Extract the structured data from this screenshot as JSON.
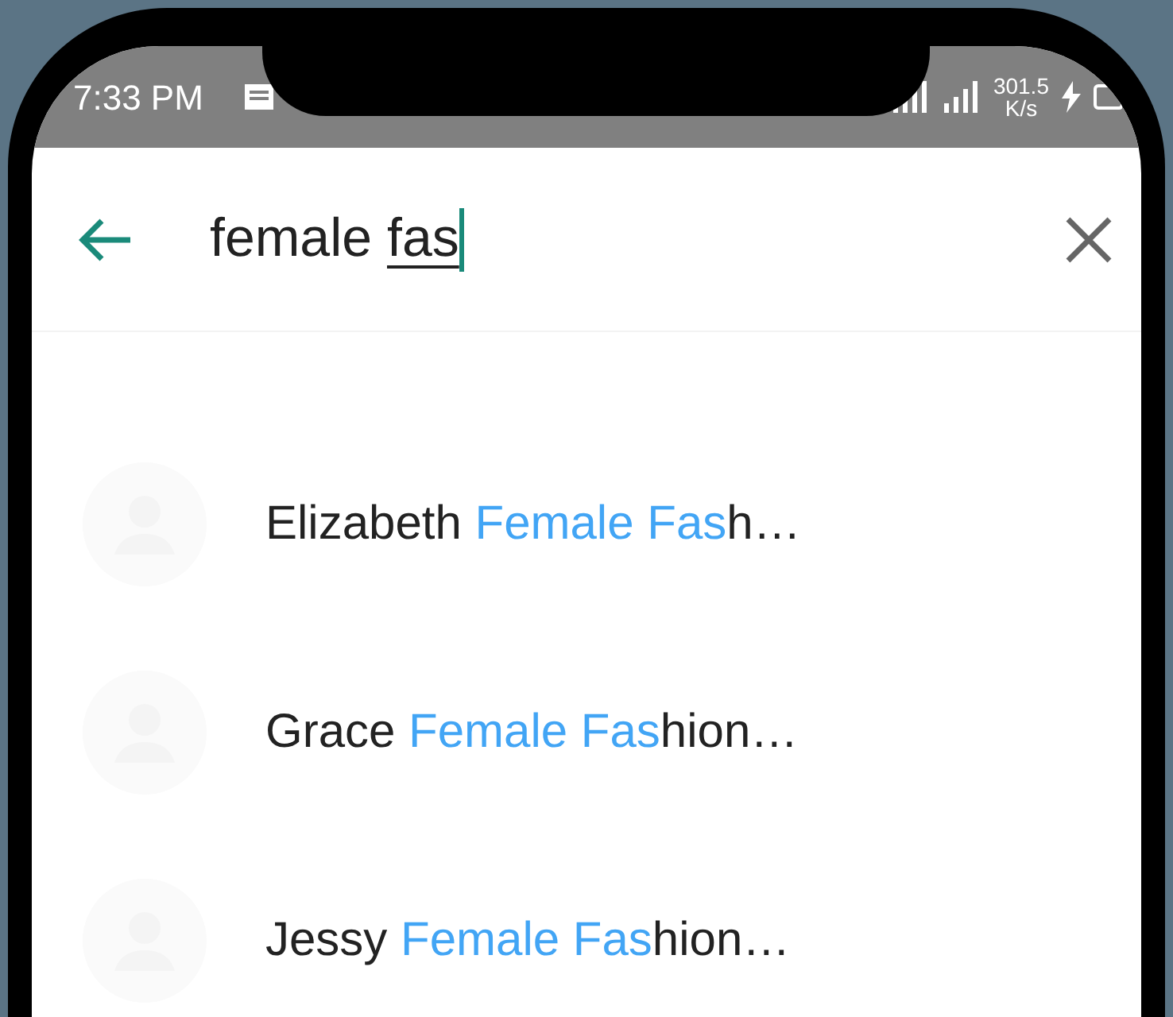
{
  "status_bar": {
    "time": "7:33 PM",
    "net_speed": "301.5",
    "net_unit": "K/s"
  },
  "search": {
    "typed": "female ",
    "composing": "fas"
  },
  "results": [
    {
      "prefix": "Elizabeth ",
      "match": "Female Fas",
      "rest": "h…"
    },
    {
      "prefix": "Grace ",
      "match": "Female Fas",
      "rest": "hion…"
    },
    {
      "prefix": "Jessy ",
      "match": "Female Fas",
      "rest": "hion…"
    }
  ]
}
